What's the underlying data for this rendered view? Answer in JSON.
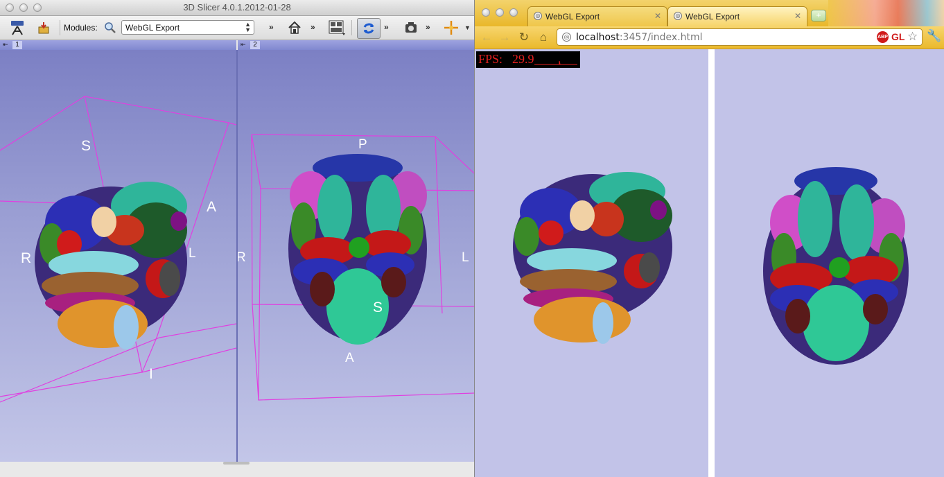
{
  "slicer": {
    "title": "3D Slicer 4.0.1.2012-01-28",
    "toolbar": {
      "modules_label": "Modules:",
      "module_selected": "WebGL Export",
      "icons": [
        "mrml-data-icon",
        "load-data-icon",
        "module-search-icon",
        "home-icon",
        "layout-icon",
        "reset-view-icon",
        "screenshot-icon",
        "crosshair-icon"
      ]
    },
    "views": [
      {
        "number": "1",
        "labels": {
          "S": "S",
          "A": "A",
          "R": "R",
          "L": "L",
          "I": "I"
        }
      },
      {
        "number": "2",
        "labels": {
          "P": "P",
          "S": "S",
          "R": "R",
          "L": "L",
          "A": "A"
        }
      }
    ]
  },
  "browser": {
    "tabs": [
      {
        "label": "WebGL Export",
        "active": false
      },
      {
        "label": "WebGL Export",
        "active": true
      }
    ],
    "url_host": "localhost",
    "url_rest": ":3457/index.html",
    "abp_badge": "ABP",
    "gl_badge": "GL",
    "fps": {
      "label": "FPS:",
      "value": "29.9"
    }
  },
  "colors": {
    "view_bar": "#8088cf",
    "bounding_box": "#e040e0",
    "browser_bg": "#c2c3e8",
    "fps_text": "#e42020"
  }
}
